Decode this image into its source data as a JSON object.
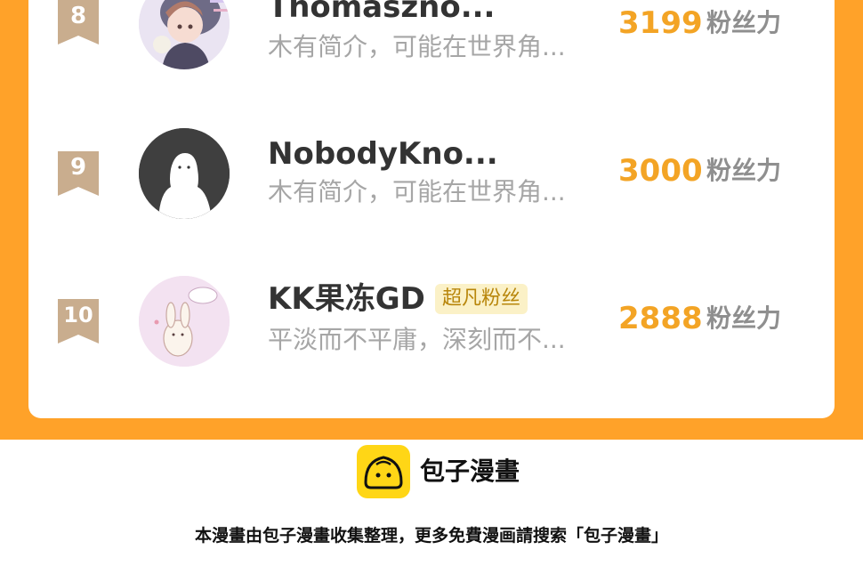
{
  "leaderboard": {
    "unit_label": "粉丝力",
    "entries": [
      {
        "rank": "8",
        "name": "Thomaszno...",
        "bio": "木有简介，可能在世界角...",
        "score": "3199",
        "tag": "",
        "avatar_icon": "anime-character-avatar-icon"
      },
      {
        "rank": "9",
        "name": "NobodyKno...",
        "bio": "木有简介，可能在世界角...",
        "score": "3000",
        "tag": "",
        "avatar_icon": "default-user-avatar-icon"
      },
      {
        "rank": "10",
        "name": "KK果冻GD",
        "bio": "平淡而不平庸，深刻而不...",
        "score": "2888",
        "tag": "超凡粉丝",
        "avatar_icon": "bunny-avatar-icon"
      }
    ]
  },
  "footer": {
    "brand": "包子漫畫",
    "note": "本漫畫由包子漫畫收集整理，更多免費漫画請搜索「包子漫畫」",
    "logo_icon": "bun-logo-icon"
  },
  "colors": {
    "panel_orange": "#FFA229",
    "score_orange": "#F3A425",
    "rank_badge": "#C9AD8E",
    "tag_bg": "#FBF1C7",
    "logo_yellow": "#FFD616"
  }
}
